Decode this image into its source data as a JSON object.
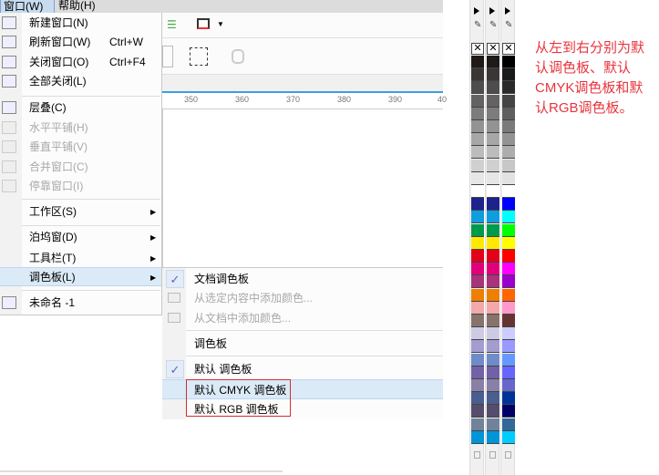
{
  "menubar": {
    "window": "窗口(W)",
    "help": "帮助(H)"
  },
  "ruler": [
    "350",
    "360",
    "370",
    "380",
    "390",
    "40"
  ],
  "menu": [
    {
      "label": "新建窗口(N)",
      "icon": "new-window-icon"
    },
    {
      "label": "刷新窗口(W)",
      "shortcut": "Ctrl+W",
      "icon": "refresh-window-icon"
    },
    {
      "label": "关闭窗口(O)",
      "shortcut": "Ctrl+F4",
      "icon": "close-window-icon"
    },
    {
      "label": "全部关闭(L)",
      "icon": "close-all-icon"
    },
    {
      "label": "层叠(C)",
      "icon": "cascade-icon"
    },
    {
      "label": "水平平铺(H)",
      "disabled": true,
      "icon": "tile-horizontal-icon"
    },
    {
      "label": "垂直平铺(V)",
      "disabled": true,
      "icon": "tile-vertical-icon"
    },
    {
      "label": "合并窗口(C)",
      "disabled": true,
      "icon": "merge-window-icon"
    },
    {
      "label": "停靠窗口(I)",
      "disabled": true,
      "icon": "dock-window-icon"
    },
    {
      "label": "工作区(S)",
      "submenu": true
    },
    {
      "label": "泊坞窗(D)",
      "submenu": true
    },
    {
      "label": "工具栏(T)",
      "submenu": true
    },
    {
      "label": "调色板(L)",
      "submenu": true,
      "highlighted": true
    },
    {
      "label": "未命名 -1",
      "icon": "document-icon"
    }
  ],
  "submenu": [
    {
      "label": "文档调色板",
      "checked": true
    },
    {
      "label": "从选定内容中添加颜色...",
      "disabled": true
    },
    {
      "label": "从文档中添加颜色...",
      "disabled": true
    },
    {
      "label": "调色板"
    },
    {
      "label": "默认 调色板",
      "checked": true
    },
    {
      "label": "默认 CMYK 调色板",
      "highlighted": true
    },
    {
      "label": "默认 RGB 调色板"
    }
  ],
  "annotation": "从左到右分别为默认调色板、默认CMYK调色板和默认RGB调色板。",
  "palettes": [
    [
      "#1f1a17",
      "#3a3636",
      "#4e4c4c",
      "#646262",
      "#7c7c7c",
      "#939393",
      "#a7a7a7",
      "#bcbcbc",
      "#d0d0d0",
      "#e6e6e6",
      "#ffffff",
      "#1e228c",
      "#0e9ee0",
      "#009a4b",
      "#ffe900",
      "#e3001b",
      "#e2007a",
      "#a8327c",
      "#ee7f00",
      "#f3a8a9",
      "#87736c",
      "#cdcbe4",
      "#a39cce",
      "#6f8bca",
      "#7361a8",
      "#8980a7",
      "#4a5f8f",
      "#564d6c",
      "#71839b",
      "#0095d7"
    ],
    [
      "#1f1a17",
      "#3a3636",
      "#4e4c4c",
      "#646262",
      "#7c7c7c",
      "#939393",
      "#a7a7a7",
      "#bcbcbc",
      "#d0d0d0",
      "#e6e6e6",
      "#ffffff",
      "#1e228c",
      "#0e9ee0",
      "#009a4b",
      "#ffe900",
      "#e3001b",
      "#e2007a",
      "#a8327c",
      "#ee7f00",
      "#f3a8a9",
      "#87736c",
      "#cdcbe4",
      "#a39cce",
      "#6f8bca",
      "#7361a8",
      "#8980a7",
      "#4a5f8f",
      "#564d6c",
      "#71839b",
      "#0095d7"
    ],
    [
      "#000000",
      "#1a1a1a",
      "#2a2a2a",
      "#454545",
      "#5e5e5e",
      "#7a7a7a",
      "#939393",
      "#adadad",
      "#c7c7c7",
      "#e2e2e2",
      "#ffffff",
      "#0000ff",
      "#00ffff",
      "#00ff00",
      "#ffff00",
      "#ff0000",
      "#ff00ff",
      "#9900cc",
      "#ff6600",
      "#ff99cc",
      "#663333",
      "#ccccff",
      "#9999ff",
      "#6699ff",
      "#6666ff",
      "#6666cc",
      "#003399",
      "#000066",
      "#336699",
      "#00ccff"
    ]
  ]
}
